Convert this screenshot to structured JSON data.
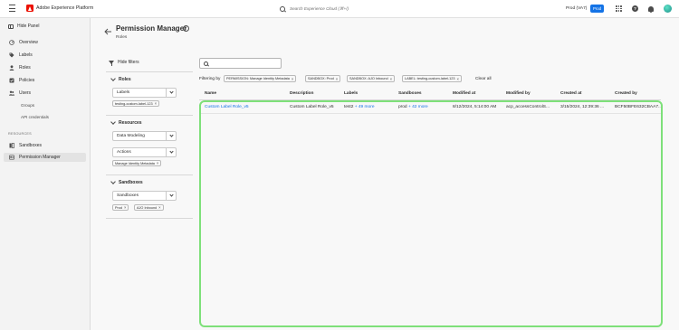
{
  "topbar": {
    "app_name": "Adobe Experience Platform",
    "search_placeholder": "Search Experience Cloud (⌘+/)",
    "sandbox_name": "Prod (VA7)",
    "prod_badge": "Prod",
    "icons": [
      "menu-icon",
      "adobe-logo",
      "search-icon",
      "apps-grid-icon",
      "help-icon",
      "notifications-bell-icon",
      "user-avatar"
    ]
  },
  "sidebar": {
    "hide_panel": "Hide Panel",
    "items": [
      {
        "label": "Overview",
        "icon": "overview-icon"
      },
      {
        "label": "Labels",
        "icon": "tag-icon"
      },
      {
        "label": "Roles",
        "icon": "user-icon"
      },
      {
        "label": "Policies",
        "icon": "policy-icon"
      },
      {
        "label": "Users",
        "icon": "users-icon"
      }
    ],
    "sub_items": [
      "Groups",
      "API credentials"
    ],
    "section_label": "RESOURCES",
    "resource_items": [
      {
        "label": "Sandboxes",
        "icon": "sandbox-icon"
      },
      {
        "label": "Permission Manager",
        "icon": "permission-manager-icon",
        "active": true
      }
    ]
  },
  "header": {
    "title": "Permission Manager",
    "subtitle": "Roles"
  },
  "filters": {
    "hide_filters": "Hide filters",
    "roles": {
      "title": "Roles",
      "picker": "Labels",
      "tags": [
        "testing-custom-label-123"
      ]
    },
    "resources": {
      "title": "Resources",
      "picker1": "Data Modeling",
      "picker2": "Actions",
      "tags": [
        "Manage Identity Metadata"
      ]
    },
    "sandboxes": {
      "title": "Sandboxes",
      "picker": "Sandboxes",
      "tags": [
        "Prod",
        "AJO Inbound"
      ]
    }
  },
  "main": {
    "filtering_by": "Filtering by",
    "chips": [
      "PERMISSION: Manage Identity Metadata",
      "SANDBOX: Prod",
      "SANDBOX: AJO Inbound",
      "LABEL: testing-custom-label-123"
    ],
    "clear_all": "Clear all",
    "columns": [
      "Name",
      "Description",
      "Labels",
      "Sandboxes",
      "Modified at",
      "Modified by",
      "Created at",
      "Created by"
    ],
    "rows": [
      {
        "name": "Custom Label Role_v5",
        "description": "Custom Label Role_v5",
        "labels": "test2",
        "labels_more": "+ 49 more",
        "sandboxes": "prod",
        "sandboxes_more": "+ 42 more",
        "modified_at": "8/12/2024, 5:14:00 AM",
        "modified_by": "acp_accessControlS...",
        "created_at": "3/15/2024, 12:39:36 ...",
        "created_by": "BCF50BFE632CBAA7..."
      }
    ]
  },
  "colors": {
    "accent": "#1473e6",
    "brand": "#eb1000",
    "highlight": "#7ee07a"
  }
}
